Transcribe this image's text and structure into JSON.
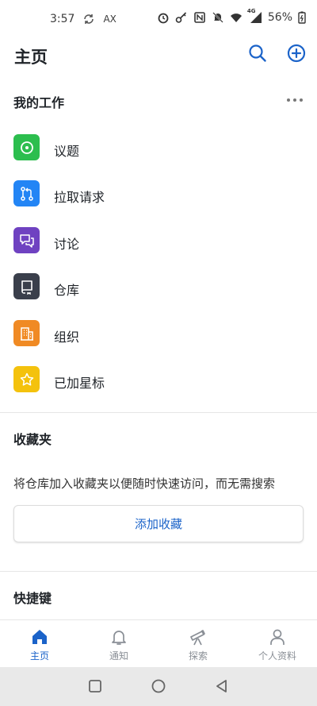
{
  "status_bar": {
    "time": "3:57",
    "carrier": "AX",
    "battery": "56%",
    "network": "4G"
  },
  "header": {
    "title": "主页"
  },
  "my_work": {
    "title": "我的工作",
    "items": [
      {
        "label": "议题",
        "icon": "issue-icon",
        "color": "#2cbe4e"
      },
      {
        "label": "拉取请求",
        "icon": "pull-request-icon",
        "color": "#2385f5"
      },
      {
        "label": "讨论",
        "icon": "discussion-icon",
        "color": "#6f42c1"
      },
      {
        "label": "仓库",
        "icon": "repo-icon",
        "color": "#3a3f4b"
      },
      {
        "label": "组织",
        "icon": "organization-icon",
        "color": "#f08a24"
      },
      {
        "label": "已加星标",
        "icon": "star-icon",
        "color": "#f4c20d"
      }
    ]
  },
  "favorites": {
    "title": "收藏夹",
    "description": "将仓库加入收藏夹以便随时快速访问，而无需搜索",
    "add_button": "添加收藏"
  },
  "shortcuts": {
    "title": "快捷键"
  },
  "tabs": [
    {
      "label": "主页",
      "icon": "home-icon",
      "active": true
    },
    {
      "label": "通知",
      "icon": "bell-icon",
      "active": false
    },
    {
      "label": "探索",
      "icon": "telescope-icon",
      "active": false
    },
    {
      "label": "个人资料",
      "icon": "person-icon",
      "active": false
    }
  ],
  "colors": {
    "accent": "#1b63c9",
    "text": "#1f2328",
    "muted": "#8a8f96"
  }
}
